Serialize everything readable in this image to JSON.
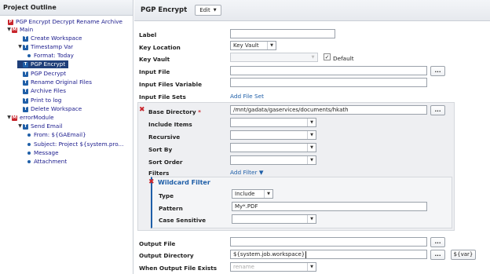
{
  "left_panel": {
    "title": "Project Outline",
    "tree": [
      {
        "label": "PGP Encrypt Decrypt Rename Archive",
        "icon": "project-icon",
        "toggle": ""
      },
      {
        "label": "Main",
        "icon": "module-icon",
        "toggle": "▼"
      },
      {
        "label": "Create Workspace",
        "icon": "task-icon",
        "toggle": ""
      },
      {
        "label": "Timestamp Var",
        "icon": "task-icon",
        "toggle": "▼"
      },
      {
        "label": "Format: Today",
        "icon": "bullet-icon",
        "toggle": ""
      },
      {
        "label": "PGP Encrypt",
        "icon": "task-icon",
        "toggle": ""
      },
      {
        "label": "PGP Decrypt",
        "icon": "task-icon",
        "toggle": ""
      },
      {
        "label": "Rename Original Files",
        "icon": "task-icon",
        "toggle": ""
      },
      {
        "label": "Archive Files",
        "icon": "task-icon",
        "toggle": ""
      },
      {
        "label": "Print to log",
        "icon": "task-icon",
        "toggle": ""
      },
      {
        "label": "Delete Workspace",
        "icon": "task-icon",
        "toggle": ""
      },
      {
        "label": "errorModule",
        "icon": "module-icon",
        "toggle": "▼"
      },
      {
        "label": "Send Email",
        "icon": "task-icon",
        "toggle": "▼"
      },
      {
        "label": "From: ${GAEmail}",
        "icon": "bullet-icon",
        "toggle": ""
      },
      {
        "label": "Subject: Project ${system.pro...",
        "icon": "bullet-icon",
        "toggle": ""
      },
      {
        "label": "Message",
        "icon": "bullet-icon",
        "toggle": ""
      },
      {
        "label": "Attachment",
        "icon": "bullet-icon",
        "toggle": ""
      }
    ]
  },
  "right_panel": {
    "title": "PGP Encrypt",
    "edit_label": "Edit",
    "labels": {
      "label": "Label",
      "key_location": "Key Location",
      "key_vault": "Key Vault",
      "input_file": "Input File",
      "input_files_variable": "Input Files Variable",
      "input_file_sets": "Input File Sets",
      "base_directory": "Base Directory",
      "include_items": "Include Items",
      "recursive": "Recursive",
      "sort_by": "Sort By",
      "sort_order": "Sort Order",
      "filters": "Filters",
      "wildcard_filter": "Wildcard Filter",
      "type": "Type",
      "pattern": "Pattern",
      "case_sensitive": "Case Sensitive",
      "output_file": "Output File",
      "output_directory": "Output Directory",
      "when_output_file_exists": "When Output File Exists"
    },
    "values": {
      "key_location": "Key Vault",
      "default_checkbox": "Default",
      "base_directory": "/mnt/gadata/gaservices/documents/hkath",
      "type": "Include",
      "pattern": "My*.PDF",
      "output_directory": "${system.job.workspace}",
      "when_output_file_exists_placeholder": "rename"
    },
    "links": {
      "add_file_set": "Add File Set",
      "add_filter": "Add Filter ▼"
    },
    "buttons": {
      "browse": "...",
      "var": "${var}"
    },
    "required_mark": "*",
    "remove_mark": "✖",
    "dropdown_caret": "▼"
  }
}
